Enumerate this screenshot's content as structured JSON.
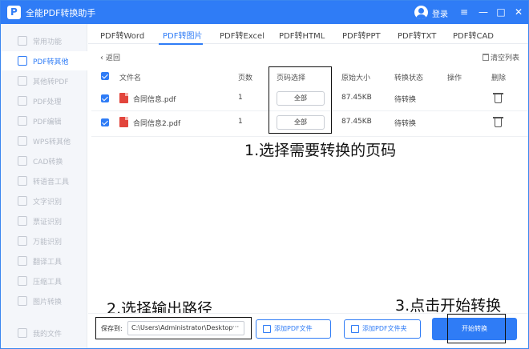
{
  "app": {
    "title": "全能PDF转换助手",
    "login_label": "登录"
  },
  "window_controls": {
    "menu": "≡",
    "minimize": "—",
    "maximize": "□",
    "close": "✕"
  },
  "sidebar": {
    "items": [
      {
        "label": "常用功能",
        "icon": "star-icon"
      },
      {
        "label": "PDF转其他",
        "icon": "pdf-export-icon",
        "active": true
      },
      {
        "label": "其他转PDF",
        "icon": "pdf-import-icon"
      },
      {
        "label": "PDF处理",
        "icon": "pdf-process-icon"
      },
      {
        "label": "PDF编辑",
        "icon": "pdf-edit-icon"
      },
      {
        "label": "WPS转其他",
        "icon": "wps-icon"
      },
      {
        "label": "CAD转换",
        "icon": "cad-icon"
      },
      {
        "label": "转语音工具",
        "icon": "audio-icon"
      },
      {
        "label": "文字识别",
        "icon": "ocr-icon"
      },
      {
        "label": "票证识别",
        "icon": "ticket-icon"
      },
      {
        "label": "万能识别",
        "icon": "scan-icon"
      },
      {
        "label": "翻译工具",
        "icon": "translate-icon"
      },
      {
        "label": "压缩工具",
        "icon": "compress-icon"
      },
      {
        "label": "图片转换",
        "icon": "image-icon"
      },
      {
        "label": "我的文件",
        "icon": "folder-icon"
      }
    ]
  },
  "tabs": [
    {
      "label": "PDF转Word"
    },
    {
      "label": "PDF转图片",
      "active": true
    },
    {
      "label": "PDF转Excel"
    },
    {
      "label": "PDF转HTML"
    },
    {
      "label": "PDF转PPT"
    },
    {
      "label": "PDF转TXT"
    },
    {
      "label": "PDF转CAD"
    }
  ],
  "toolbar": {
    "back_label": "返回",
    "clear_label": "清空列表"
  },
  "table": {
    "headers": {
      "name": "文件名",
      "pages": "页数",
      "page_select": "页码选择",
      "size": "原始大小",
      "status": "转换状态",
      "action": "操作",
      "delete": "删除"
    },
    "rows": [
      {
        "name": "合同信息.pdf",
        "pages": "1",
        "page_select": "全部",
        "size": "87.45KB",
        "status": "待转换"
      },
      {
        "name": "合同信息2.pdf",
        "pages": "1",
        "page_select": "全部",
        "size": "87.45KB",
        "status": "待转换"
      }
    ]
  },
  "annotations": {
    "step1": "1.选择需要转换的页码",
    "step2": "2.选择输出路径",
    "step3": "3.点击开始转换"
  },
  "footer": {
    "save_label": "保存到:",
    "save_path": "C:\\Users\\Administrator\\Desktop",
    "browse": "···",
    "add_file": "添加PDF文件",
    "add_folder": "添加PDF文件夹",
    "start": "开始转换"
  }
}
